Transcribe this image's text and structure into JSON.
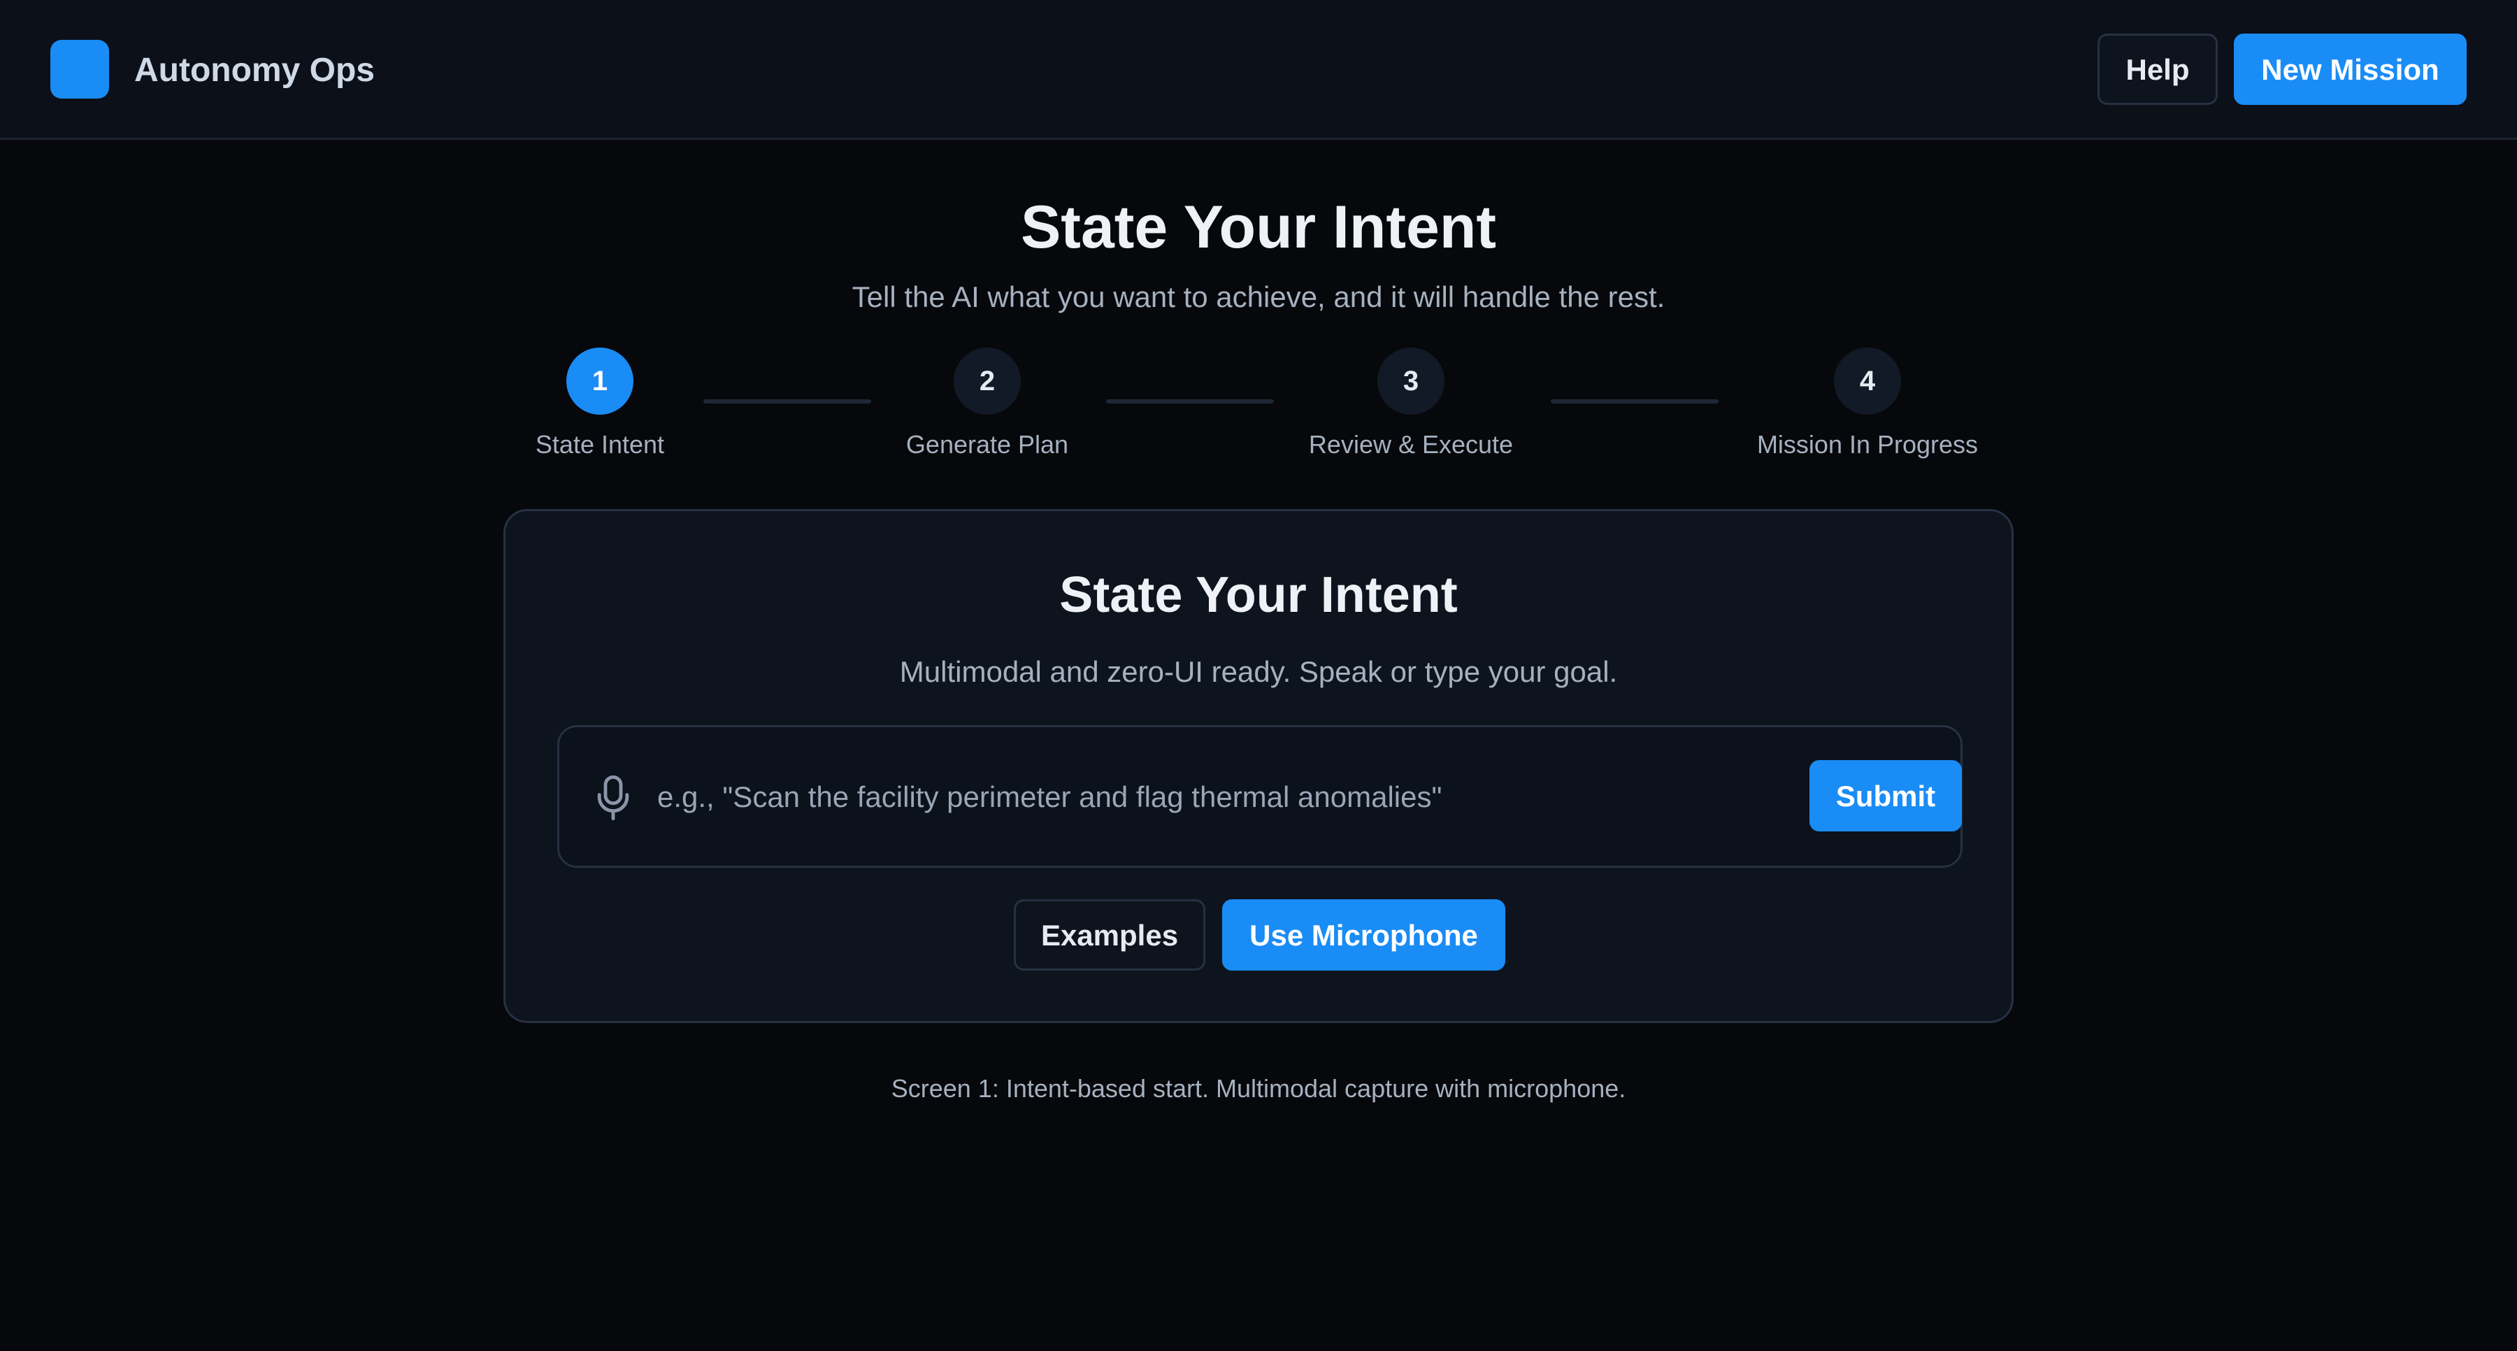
{
  "header": {
    "app_name": "Autonomy Ops",
    "help_label": "Help",
    "new_mission_label": "New Mission"
  },
  "hero": {
    "title": "State Your Intent",
    "subtitle": "Tell the AI what you want to achieve, and it will handle the rest."
  },
  "stepper": {
    "active_step": 1,
    "steps": [
      {
        "number": "1",
        "label": "State Intent"
      },
      {
        "number": "2",
        "label": "Generate Plan"
      },
      {
        "number": "3",
        "label": "Review & Execute"
      },
      {
        "number": "4",
        "label": "Mission In Progress"
      }
    ]
  },
  "card": {
    "title": "State Your Intent",
    "subtitle": "Multimodal and zero-UI ready. Speak or type your goal.",
    "input": {
      "value": "",
      "placeholder": "e.g., \"Scan the facility perimeter and flag thermal anomalies\"",
      "icon": "microphone-icon"
    },
    "submit_label": "Submit",
    "examples_label": "Examples",
    "use_microphone_label": "Use Microphone"
  },
  "caption": "Screen 1: Intent-based start. Multimodal capture with microphone.",
  "colors": {
    "accent": "#1a8cf5",
    "background": "#07080b",
    "surface": "#0e141d",
    "border": "#263142"
  }
}
